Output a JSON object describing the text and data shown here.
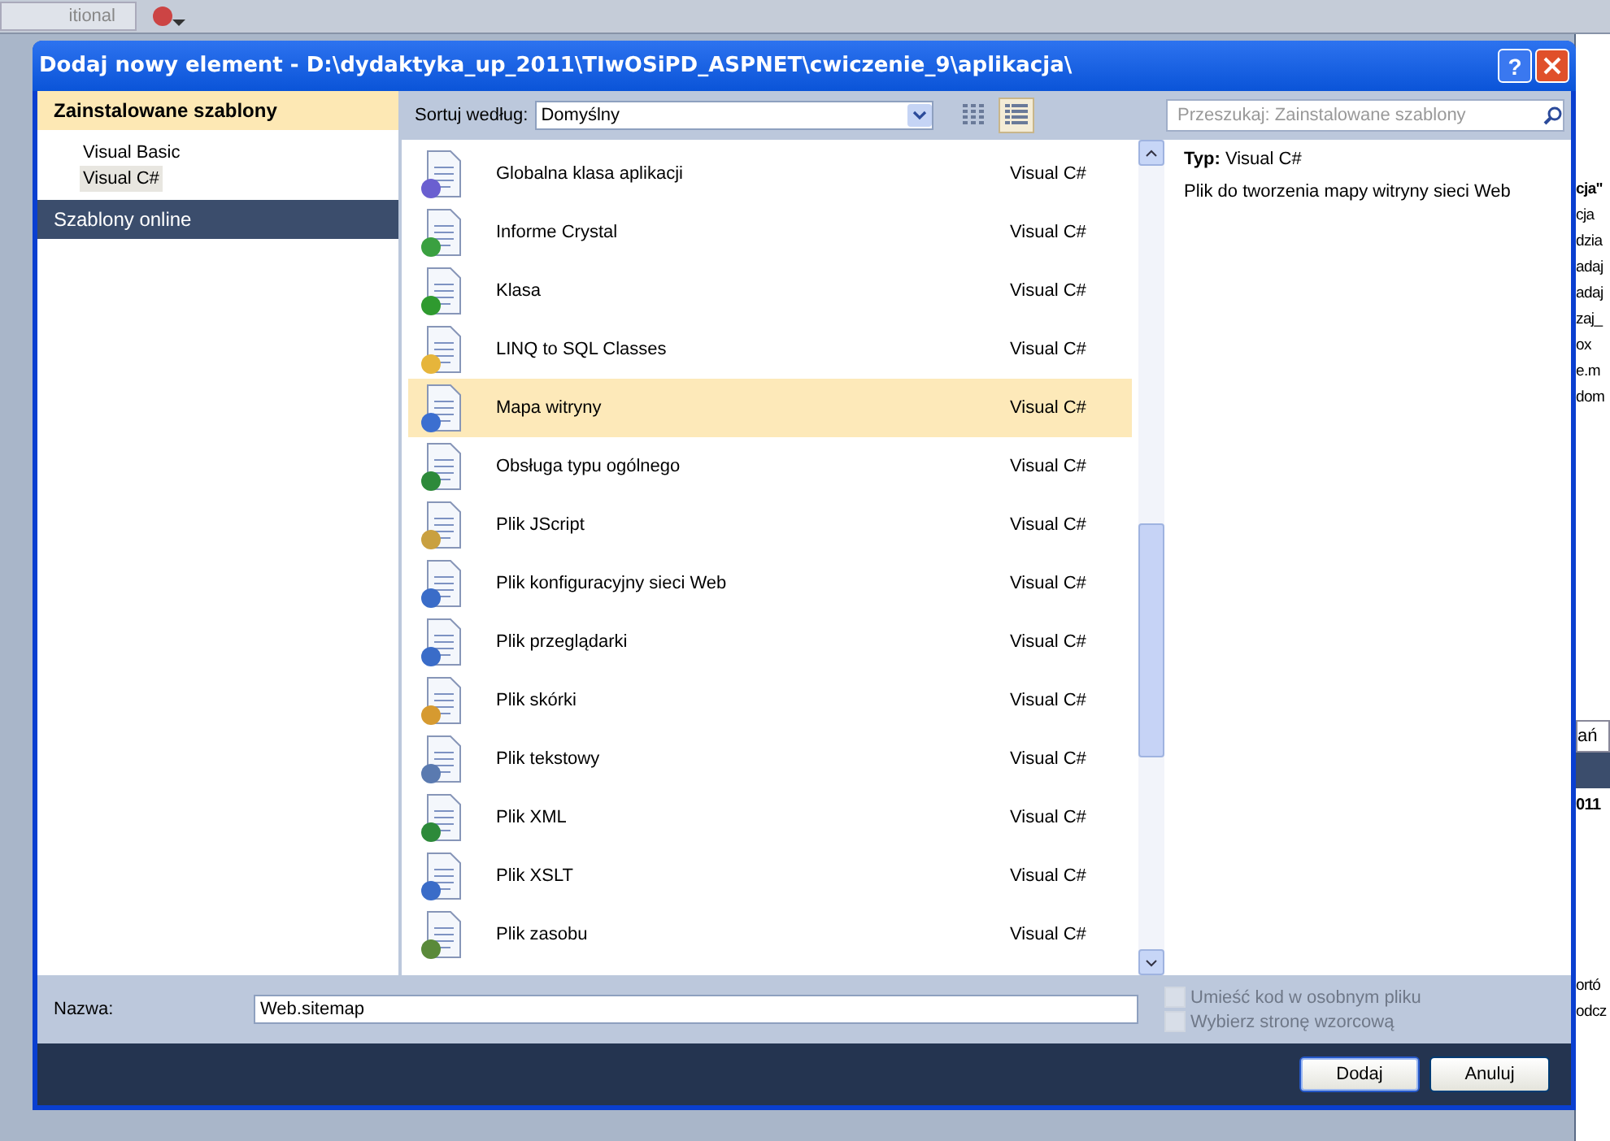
{
  "background": {
    "toolbar_combo": "itional",
    "side_fragments": [
      {
        "text": "cja\"",
        "bold": true
      },
      {
        "text": "cja",
        "bold": false
      },
      {
        "text": "dzia",
        "bold": false
      },
      {
        "text": "adaj",
        "bold": false
      },
      {
        "text": "adaj",
        "bold": false
      },
      {
        "text": "zaj_",
        "bold": false
      },
      {
        "text": "ox",
        "bold": false
      },
      {
        "text": "e.m",
        "bold": false
      },
      {
        "text": "dom",
        "bold": false
      }
    ],
    "tab_fragment": "ań",
    "heading_fragment": "011",
    "lower_fragments": [
      "ortó",
      "odcz"
    ]
  },
  "window": {
    "title": "Dodaj nowy element - D:\\dydaktyka_up_2011\\TIwOSiPD_ASPNET\\cwiczenie_9\\aplikacja\\",
    "help": "?"
  },
  "sidebar": {
    "sections": [
      {
        "label": "Zainstalowane szablony",
        "selected": true,
        "items": [
          {
            "label": "Visual Basic",
            "selected": false
          },
          {
            "label": "Visual C#",
            "selected": true
          }
        ]
      },
      {
        "label": "Szablony online",
        "selected": false
      }
    ]
  },
  "toolbar": {
    "sort_label": "Sortuj według:",
    "sort_value": "Domyślny",
    "views": [
      {
        "kind": "icons",
        "selected": false
      },
      {
        "kind": "list",
        "selected": true
      }
    ],
    "search": {
      "placeholder": "Przeszukaj: Zainstalowane szablony"
    }
  },
  "templates": [
    {
      "name": "Globalna klasa aplikacji",
      "type": "Visual C#",
      "selected": false
    },
    {
      "name": "Informe Crystal",
      "type": "Visual C#",
      "selected": false
    },
    {
      "name": "Klasa",
      "type": "Visual C#",
      "selected": false
    },
    {
      "name": "LINQ to SQL Classes",
      "type": "Visual C#",
      "selected": false
    },
    {
      "name": "Mapa witryny",
      "type": "Visual C#",
      "selected": true
    },
    {
      "name": "Obsługa typu ogólnego",
      "type": "Visual C#",
      "selected": false
    },
    {
      "name": "Plik JScript",
      "type": "Visual C#",
      "selected": false
    },
    {
      "name": "Plik konfiguracyjny sieci Web",
      "type": "Visual C#",
      "selected": false
    },
    {
      "name": "Plik przeglądarki",
      "type": "Visual C#",
      "selected": false
    },
    {
      "name": "Plik skórki",
      "type": "Visual C#",
      "selected": false
    },
    {
      "name": "Plik tekstowy",
      "type": "Visual C#",
      "selected": false
    },
    {
      "name": "Plik XML",
      "type": "Visual C#",
      "selected": false
    },
    {
      "name": "Plik XSLT",
      "type": "Visual C#",
      "selected": false
    },
    {
      "name": "Plik zasobu",
      "type": "Visual C#",
      "selected": false
    }
  ],
  "details": {
    "type_label": "Typ:",
    "type_value": "Visual C#",
    "description": "Plik do tworzenia mapy witryny sieci Web"
  },
  "name_field": {
    "label": "Nazwa:",
    "value": "Web.sitemap"
  },
  "options": [
    {
      "label": "Umieść kod w osobnym pliku",
      "checked": false,
      "disabled": true
    },
    {
      "label": "Wybierz stronę wzorcową",
      "checked": false,
      "disabled": true
    }
  ],
  "buttons": [
    {
      "label": "Dodaj",
      "default": true
    },
    {
      "label": "Anuluj",
      "default": false
    }
  ]
}
